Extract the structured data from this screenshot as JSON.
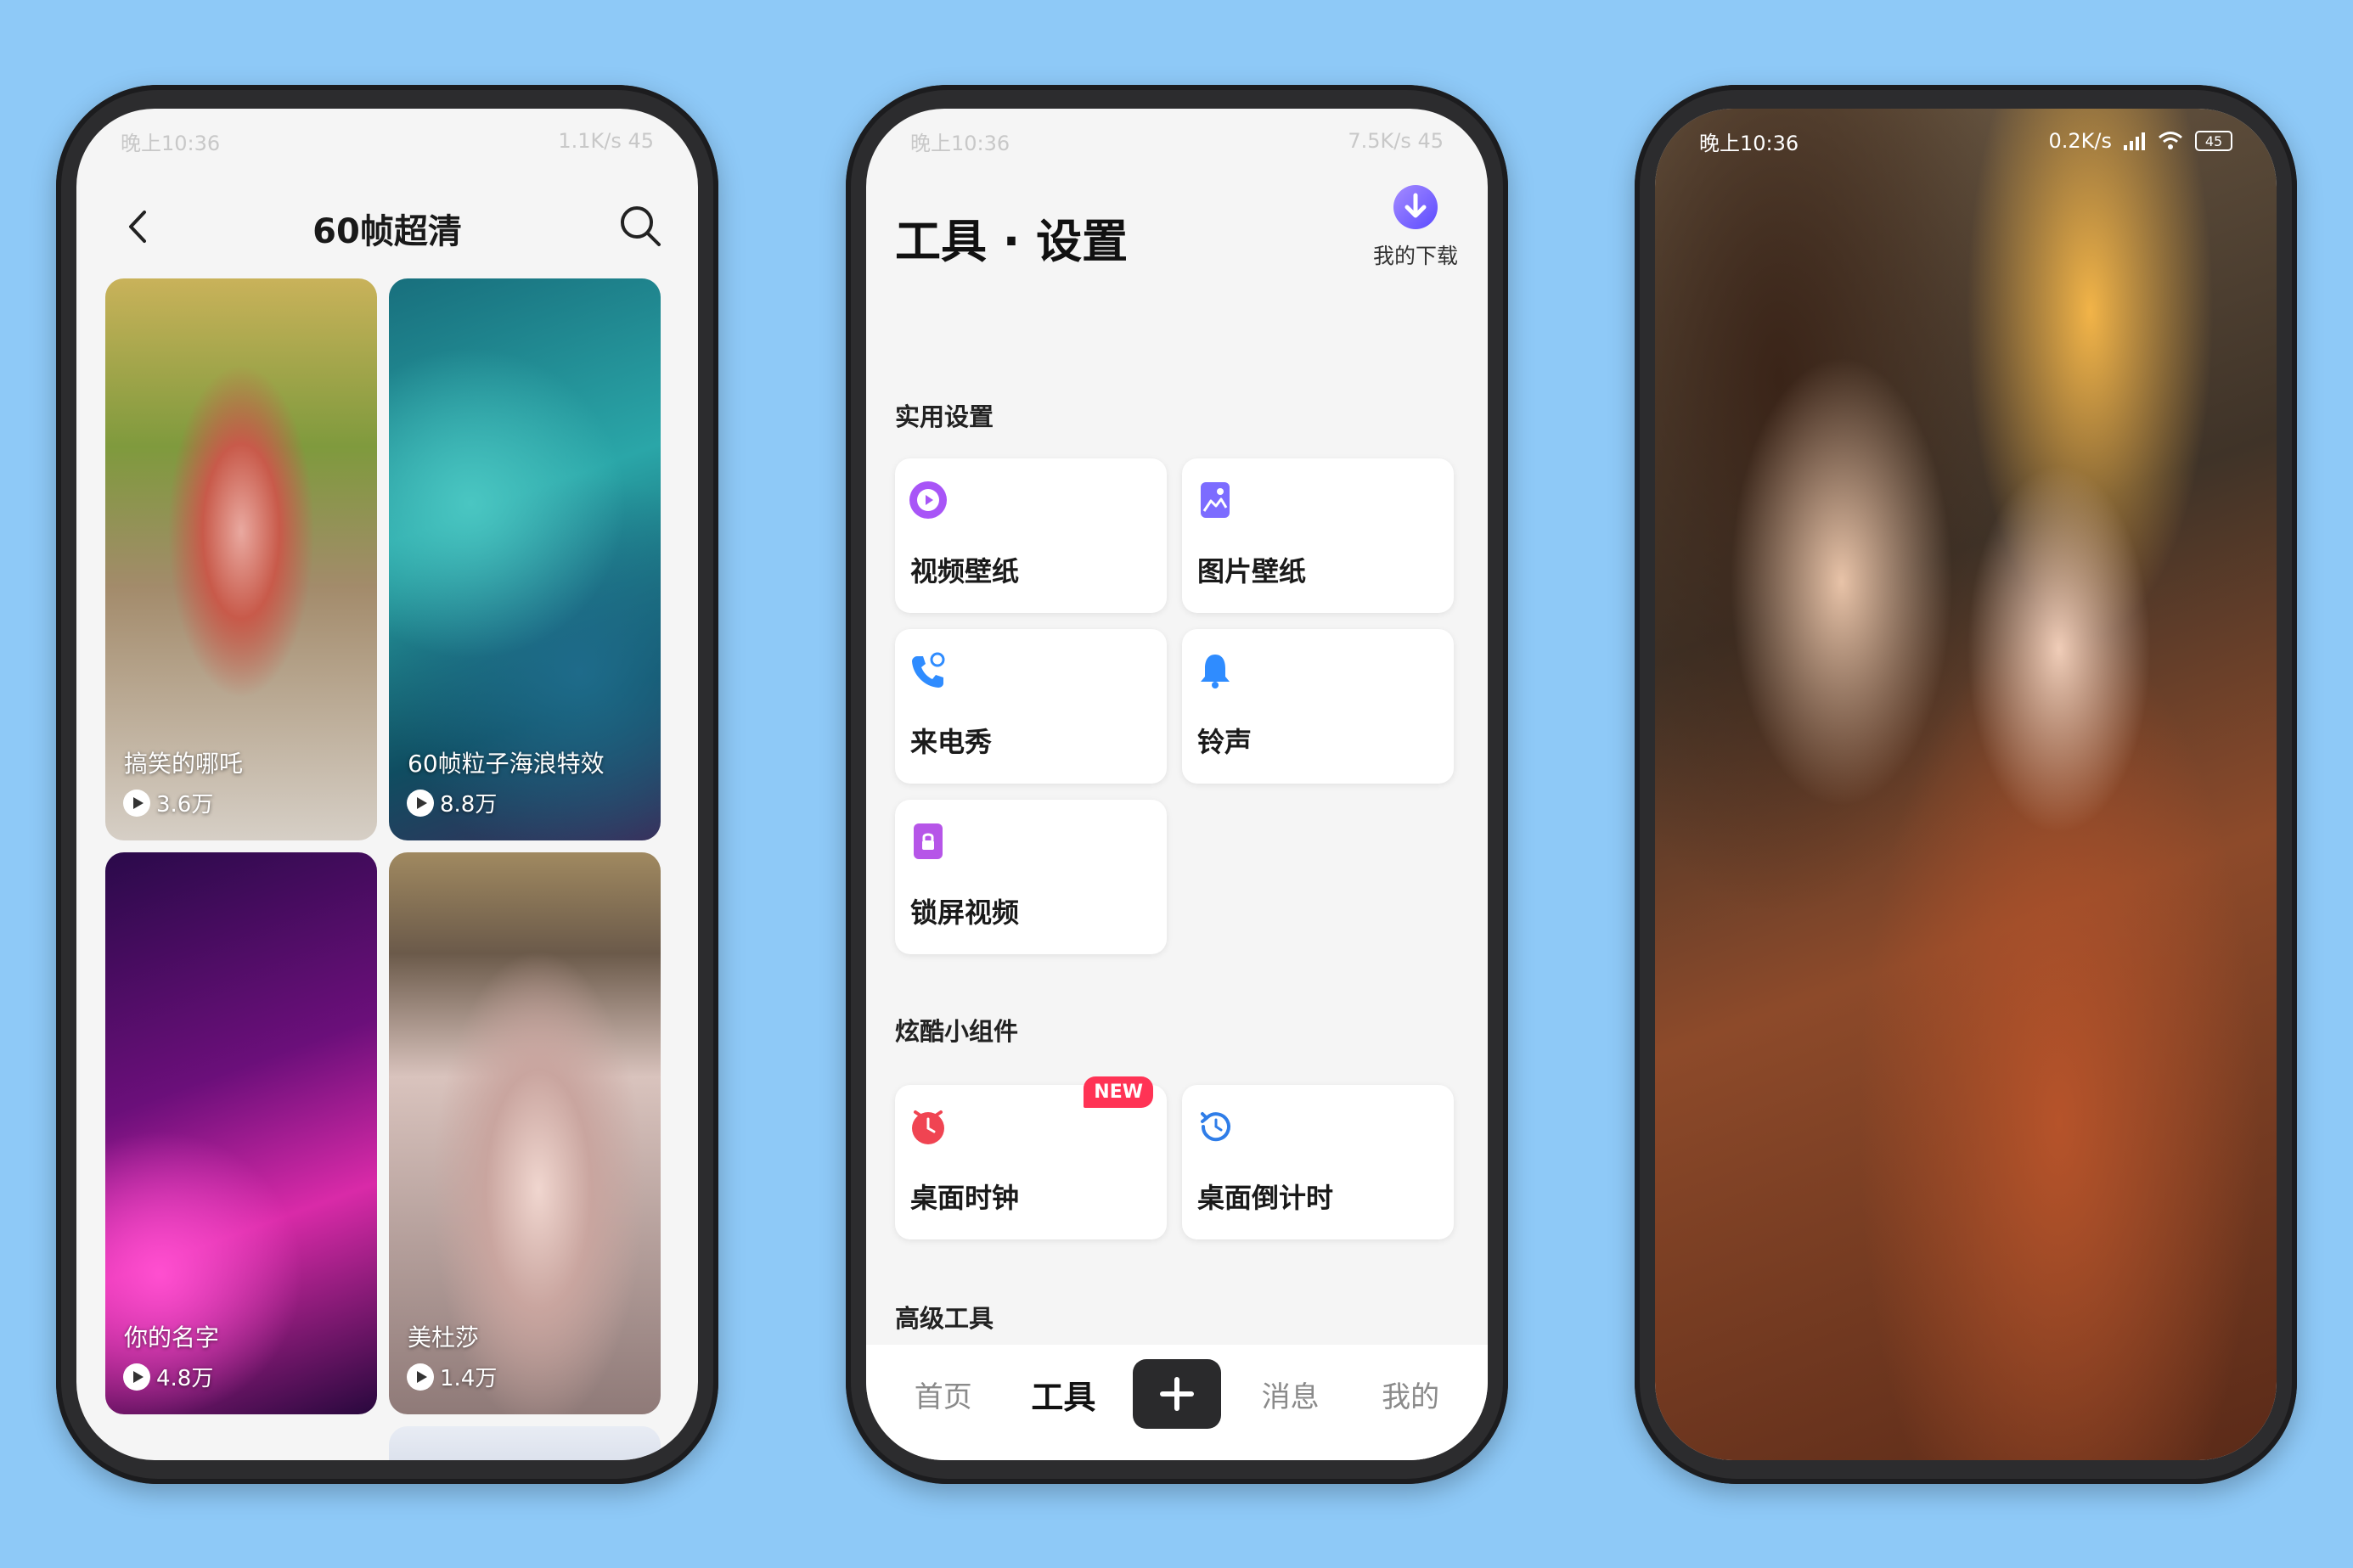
{
  "screen1": {
    "status_left": "晚上10:36",
    "status_right": "1.1K/s 45",
    "title": "60帧超清",
    "cards": [
      {
        "title": "搞笑的哪吒",
        "plays": "3.6万"
      },
      {
        "title": "60帧粒子海浪特效",
        "plays": "8.8万"
      },
      {
        "title": "你的名字",
        "plays": "4.8万"
      },
      {
        "title": "美杜莎",
        "plays": "1.4万"
      }
    ]
  },
  "screen2": {
    "status_left": "晚上10:36",
    "status_right": "7.5K/s 45",
    "title": "工具 · 设置",
    "download_label": "我的下载",
    "sections": {
      "practical": "实用设置",
      "widgets": "炫酷小组件",
      "advanced": "高级工具"
    },
    "tiles": {
      "video_wallpaper": "视频壁纸",
      "image_wallpaper": "图片壁纸",
      "caller_show": "来电秀",
      "ringtone": "铃声",
      "lock_video": "锁屏视频",
      "desktop_clock": "桌面时钟",
      "desktop_countdown": "桌面倒计时"
    },
    "new_badge": "NEW",
    "tabs": {
      "home": "首页",
      "tools": "工具",
      "messages": "消息",
      "mine": "我的"
    },
    "colors": {
      "accent_purple": "#8a5cf6",
      "clock_red": "#f04452",
      "bell_blue": "#2f8cff"
    }
  },
  "screen3": {
    "status_left": "晚上10:36",
    "status_right": "0.2K/s",
    "battery": "45"
  }
}
